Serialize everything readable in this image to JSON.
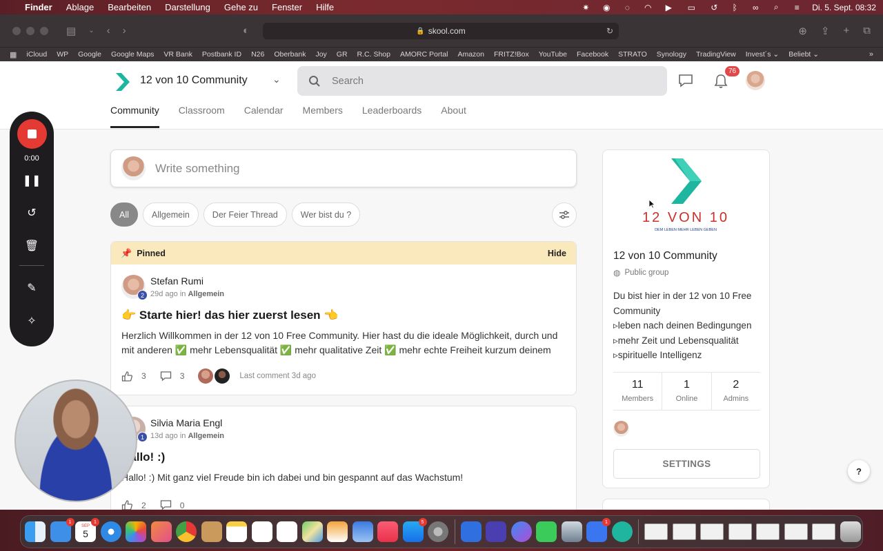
{
  "menubar": {
    "app": "Finder",
    "items": [
      "Ablage",
      "Bearbeiten",
      "Darstellung",
      "Gehe zu",
      "Fenster",
      "Hilfe"
    ],
    "datetime": "Di. 5. Sept.  08:32"
  },
  "browser": {
    "url": "skool.com",
    "bookmarks": [
      "iCloud",
      "WP",
      "Google",
      "Google Maps",
      "VR Bank",
      "Postbank ID",
      "N26",
      "Oberbank",
      "Joy",
      "GR",
      "R.C. Shop",
      "AMORC Portal",
      "Amazon",
      "FRITZ!Box",
      "YouTube",
      "Facebook",
      "STRATO",
      "Synology",
      "TradingView",
      "Invest´s ⌄",
      "Beliebt ⌄"
    ]
  },
  "header": {
    "group_name": "12 von 10 Community",
    "search_placeholder": "Search",
    "notification_count": "76",
    "tabs": [
      "Community",
      "Classroom",
      "Calendar",
      "Members",
      "Leaderboards",
      "About"
    ]
  },
  "composer": {
    "placeholder": "Write something"
  },
  "filters": [
    "All",
    "Allgemein",
    "Der Feier Thread",
    "Wer bist du ?"
  ],
  "posts": [
    {
      "pinned_label": "Pinned",
      "hide_label": "Hide",
      "author": "Stefan Rumi",
      "level": "2",
      "time": "29d ago",
      "in_word": "in",
      "category": "Allgemein",
      "title": "👉 Starte hier! das hier zuerst lesen 👈",
      "body": "Herzlich Willkommen in der 12 von 10 Free Community. Hier hast du die ideale Möglichkeit, durch und mit anderen ✅ mehr Lebensqualität ✅ mehr qualitative Zeit ✅ mehr echte Freiheit kurzum deinem",
      "likes": "3",
      "comments": "3",
      "last_comment": "Last comment 3d ago"
    },
    {
      "author": "Silvia Maria Engl",
      "level": "1",
      "time": "13d ago",
      "in_word": "in",
      "category": "Allgemein",
      "title": "Hallo! :)",
      "body": "Hallo! :) Mit ganz viel Freude bin ich dabei und bin gespannt auf das Wachstum!",
      "likes": "2",
      "comments": "0"
    }
  ],
  "sidebar": {
    "logo_text": "12 VON 10",
    "logo_tagline": "DEM LEBEN MEHR LEBEN GEBEN",
    "name": "12 von 10 Community",
    "type": "Public group",
    "description": [
      "Du bist hier in der 12 von 10 Free Community",
      "▹leben nach deinen Bedingungen",
      "▹mehr Zeit und Lebensqualität",
      "▹spirituelle Intelligenz"
    ],
    "stats": [
      {
        "value": "11",
        "label": "Members"
      },
      {
        "value": "1",
        "label": "Online"
      },
      {
        "value": "2",
        "label": "Admins"
      }
    ],
    "settings_label": "SETTINGS"
  },
  "help_label": "?",
  "recorder": {
    "time": "0:00"
  },
  "dock": {
    "badges": {
      "mail": "1",
      "calendar": "1",
      "appstore": "5",
      "signal": "1"
    },
    "calendar_month": "SEP",
    "calendar_day": "5"
  },
  "colors": {
    "accent_teal": "#1fb6a0",
    "logo_red": "#c8302c",
    "pinned_bg": "#fae9bd",
    "record_red": "#e53a33"
  }
}
